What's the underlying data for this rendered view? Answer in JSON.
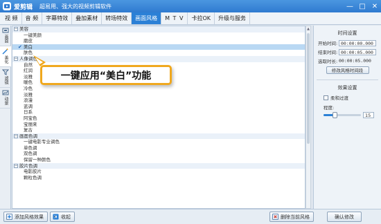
{
  "window": {
    "app_name": "爱剪辑",
    "slogan": "超易用、强大的视频剪辑软件",
    "controls": [
      "—",
      "□",
      "✕"
    ]
  },
  "tabs": [
    {
      "label": "视 频",
      "active": false
    },
    {
      "label": "音 频",
      "active": false
    },
    {
      "label": "字幕特效",
      "active": false
    },
    {
      "label": "叠加素材",
      "active": false
    },
    {
      "label": "转场特效",
      "active": false
    },
    {
      "label": "画面风格",
      "active": true
    },
    {
      "label": "M T V",
      "active": false
    },
    {
      "label": "卡拉OK",
      "active": false
    },
    {
      "label": "升级与服务",
      "active": false
    }
  ],
  "side_tabs": [
    {
      "label": "画面",
      "icon": "frame-icon",
      "active": false
    },
    {
      "label": "美化",
      "icon": "magic-wand-icon",
      "active": true
    },
    {
      "label": "滤镜",
      "icon": "filter-icon",
      "active": false
    },
    {
      "label": "动景",
      "icon": "motion-icon",
      "active": false
    }
  ],
  "list": [
    {
      "type": "group",
      "label": "美容"
    },
    {
      "type": "item",
      "label": "一键美颜"
    },
    {
      "type": "item",
      "label": "磨皮"
    },
    {
      "type": "item",
      "label": "美白",
      "selected": true
    },
    {
      "type": "item",
      "label": "肤色"
    },
    {
      "type": "group",
      "label": "人像调色"
    },
    {
      "type": "item",
      "label": "自然"
    },
    {
      "type": "item",
      "label": "红润"
    },
    {
      "type": "item",
      "label": "淡雅"
    },
    {
      "type": "item",
      "label": "暖色"
    },
    {
      "type": "item",
      "label": "冷色"
    },
    {
      "type": "item",
      "label": "淡雅"
    },
    {
      "type": "item",
      "label": "浪漫"
    },
    {
      "type": "item",
      "label": "蓝调"
    },
    {
      "type": "item",
      "label": "日系"
    },
    {
      "type": "item",
      "label": "阿宝色"
    },
    {
      "type": "item",
      "label": "宝丽来"
    },
    {
      "type": "item",
      "label": "复古"
    },
    {
      "type": "group",
      "label": "画面色调"
    },
    {
      "type": "item",
      "label": "一键电影专业调色"
    },
    {
      "type": "item",
      "label": "单色调"
    },
    {
      "type": "item",
      "label": "双色调"
    },
    {
      "type": "item",
      "label": "保留一种颜色"
    },
    {
      "type": "group",
      "label": "胶片色调"
    },
    {
      "type": "item",
      "label": "电影胶片"
    },
    {
      "type": "item",
      "label": "颗粒色调"
    }
  ],
  "callout": {
    "text": "一键应用“美白”功能"
  },
  "time_settings": {
    "title": "时间设置",
    "start_label": "开始时间:",
    "start_value": "00:00:00.000",
    "end_label": "结束时间:",
    "end_value": "00:00:05.000",
    "duration_label": "选取时长:",
    "duration_value": "00:00:05.000",
    "modify_button": "修改风格时间段"
  },
  "effect_settings": {
    "title": "效果设置",
    "fade_label": "柔和过渡",
    "fade_checked": false,
    "degree_label": "程度:",
    "degree_value": "15",
    "degree_fraction": 0.3
  },
  "bottom": {
    "add_style": "添加风格效果",
    "favorite": "收起",
    "delete_style": "删除当前风格",
    "confirm": "确认修改"
  }
}
